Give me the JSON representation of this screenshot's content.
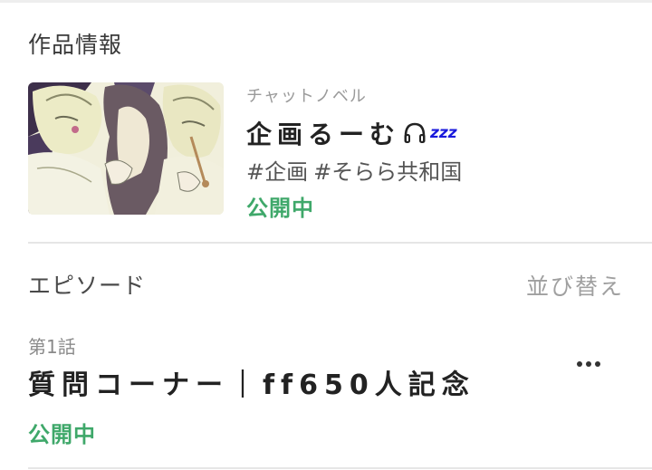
{
  "work_section": {
    "title": "作品情報",
    "cover_alt": "cover-illustration",
    "category": "チャットノベル",
    "work_title": "企画るーむ",
    "title_icon": "headphone-icon",
    "title_suffix": "zzz",
    "tags": [
      "#企画",
      "#そらら共和国"
    ],
    "status": "公開中"
  },
  "episodes_section": {
    "title": "エピソード",
    "sort_label": "並び替え",
    "episodes": [
      {
        "number": "第1話",
        "title": "質問コーナー｜ff650人記念",
        "status": "公開中"
      }
    ]
  },
  "colors": {
    "status_green": "#3fa86a",
    "zzz_blue": "#1a1adc",
    "divider": "#e6e6e6"
  }
}
